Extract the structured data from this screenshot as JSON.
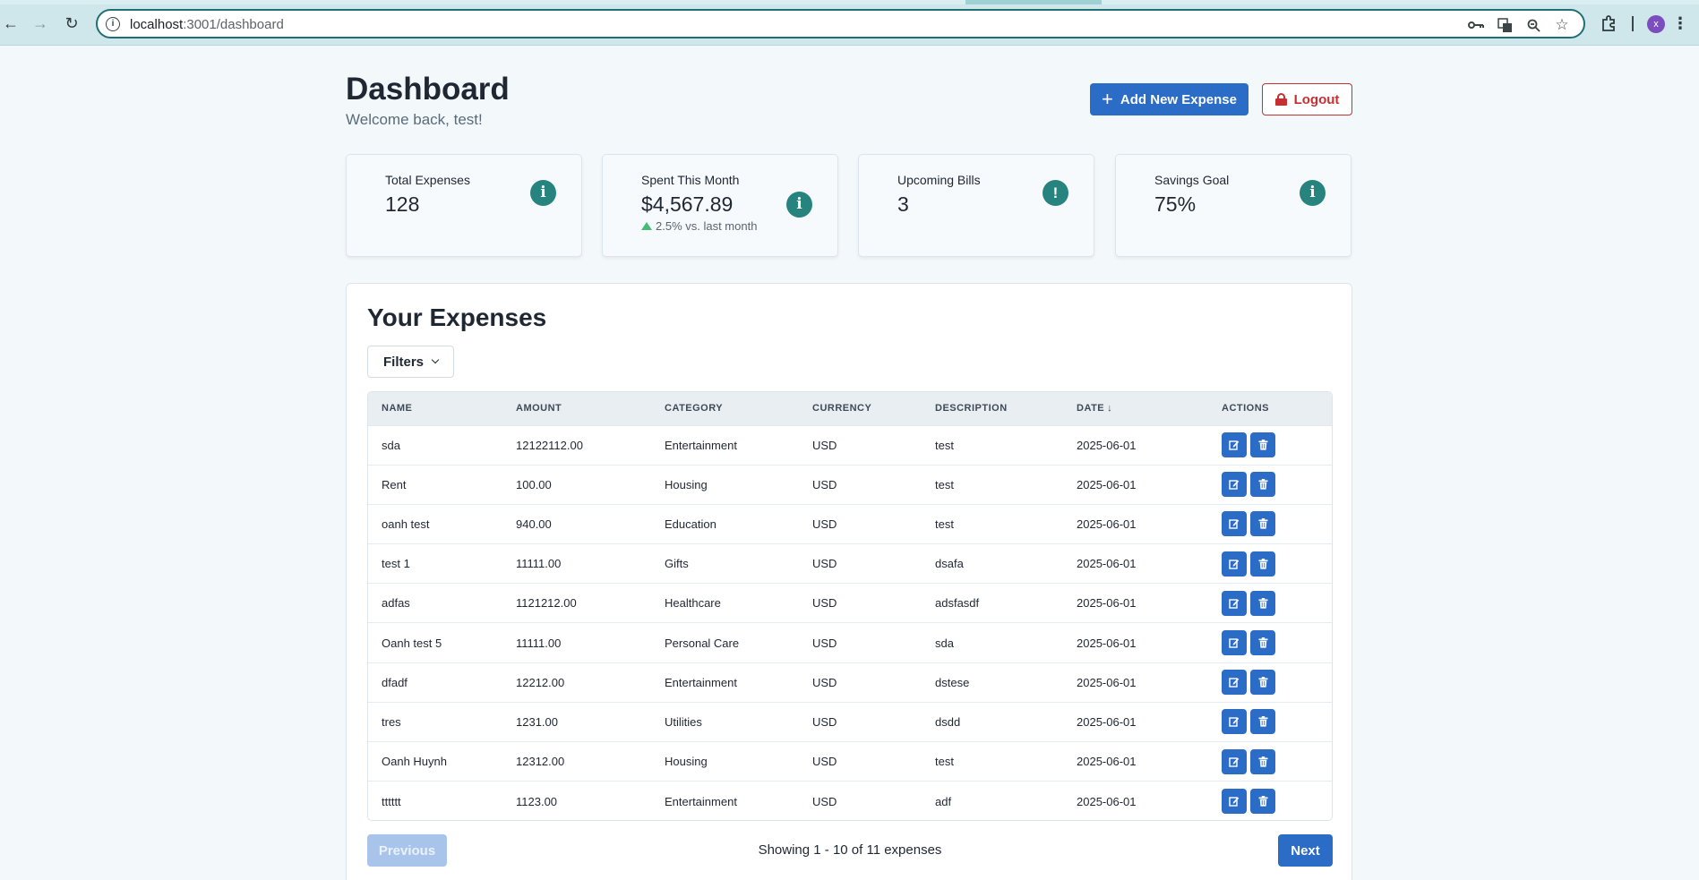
{
  "browser": {
    "url_host": "localhost",
    "url_path": ":3001/dashboard",
    "profile_initial": "x"
  },
  "header": {
    "title": "Dashboard",
    "subtitle": "Welcome back, test!",
    "add_button": "Add New Expense",
    "logout_button": "Logout"
  },
  "stats": [
    {
      "label": "Total Expenses",
      "value": "128",
      "icon": "info-icon"
    },
    {
      "label": "Spent This Month",
      "value": "$4,567.89",
      "sub": "2.5% vs. last month",
      "icon": "info-icon"
    },
    {
      "label": "Upcoming Bills",
      "value": "3",
      "icon": "alert-icon"
    },
    {
      "label": "Savings Goal",
      "value": "75%",
      "icon": "info-icon"
    }
  ],
  "expenses": {
    "title": "Your Expenses",
    "filters_label": "Filters",
    "columns": [
      "NAME",
      "AMOUNT",
      "CATEGORY",
      "CURRENCY",
      "DESCRIPTION",
      "DATE",
      "ACTIONS"
    ],
    "rows": [
      {
        "name": "sda",
        "amount": "12122112.00",
        "category": "Entertainment",
        "currency": "USD",
        "description": "test",
        "date": "2025-06-01"
      },
      {
        "name": "Rent",
        "amount": "100.00",
        "category": "Housing",
        "currency": "USD",
        "description": "test",
        "date": "2025-06-01"
      },
      {
        "name": "oanh test",
        "amount": "940.00",
        "category": "Education",
        "currency": "USD",
        "description": "test",
        "date": "2025-06-01"
      },
      {
        "name": "test 1",
        "amount": "11111.00",
        "category": "Gifts",
        "currency": "USD",
        "description": "dsafa",
        "date": "2025-06-01"
      },
      {
        "name": "adfas",
        "amount": "1121212.00",
        "category": "Healthcare",
        "currency": "USD",
        "description": "adsfasdf",
        "date": "2025-06-01"
      },
      {
        "name": "Oanh test 5",
        "amount": "11111.00",
        "category": "Personal Care",
        "currency": "USD",
        "description": "sda",
        "date": "2025-06-01"
      },
      {
        "name": "dfadf",
        "amount": "12212.00",
        "category": "Entertainment",
        "currency": "USD",
        "description": "dstese",
        "date": "2025-06-01"
      },
      {
        "name": "tres",
        "amount": "1231.00",
        "category": "Utilities",
        "currency": "USD",
        "description": "dsdd",
        "date": "2025-06-01"
      },
      {
        "name": "Oanh Huynh",
        "amount": "12312.00",
        "category": "Housing",
        "currency": "USD",
        "description": "test",
        "date": "2025-06-01"
      },
      {
        "name": "tttttt",
        "amount": "1123.00",
        "category": "Entertainment",
        "currency": "USD",
        "description": "adf",
        "date": "2025-06-01"
      }
    ],
    "pagination": {
      "previous_label": "Previous",
      "next_label": "Next",
      "info": "Showing 1 - 10 of 11 expenses"
    }
  },
  "colors": {
    "primary": "#2b6cc6",
    "danger": "#c53030",
    "icon_teal": "#26837e",
    "positive": "#48bb78"
  }
}
